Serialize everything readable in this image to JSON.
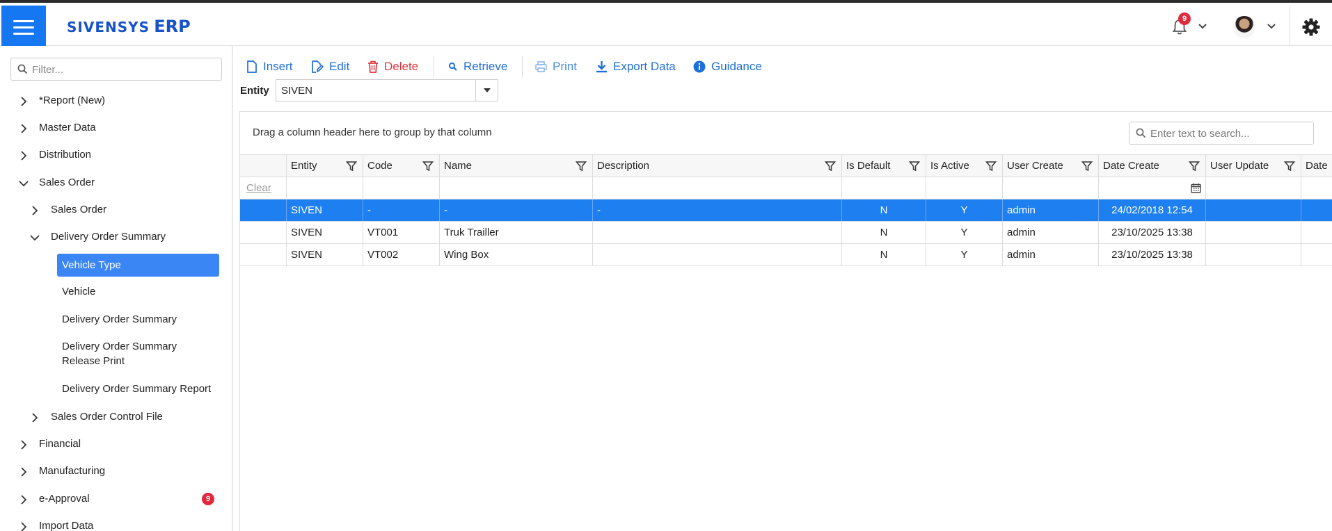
{
  "app": {
    "brand_part1": "SIVENSYS",
    "brand_part2": "ERP",
    "notification_count": "9"
  },
  "sidebar": {
    "filter_placeholder": "Filter...",
    "items": [
      {
        "label": "*Report (New)"
      },
      {
        "label": "Master Data"
      },
      {
        "label": "Distribution"
      },
      {
        "label": "Sales Order"
      },
      {
        "label": "Sales Order"
      },
      {
        "label": "Delivery Order Summary"
      },
      {
        "label": "Vehicle Type"
      },
      {
        "label": "Vehicle"
      },
      {
        "label": "Delivery Order Summary"
      },
      {
        "label": "Delivery Order Summary"
      },
      {
        "label": "Release Print"
      },
      {
        "label": "Delivery Order Summary Report"
      },
      {
        "label": "Sales Order Control File"
      },
      {
        "label": "Financial"
      },
      {
        "label": "Manufacturing"
      },
      {
        "label": "e-Approval",
        "badge": "9"
      },
      {
        "label": "Import Data"
      }
    ]
  },
  "toolbar": {
    "insert": "Insert",
    "edit": "Edit",
    "delete": "Delete",
    "retrieve": "Retrieve",
    "print": "Print",
    "export": "Export Data",
    "guidance": "Guidance"
  },
  "entity": {
    "label": "Entity",
    "value": "SIVEN"
  },
  "grid": {
    "group_hint": "Drag a column header here to group by that column",
    "search_placeholder": "Enter text to search...",
    "clear_label": "Clear",
    "columns": [
      "Entity",
      "Code",
      "Name",
      "Description",
      "Is Default",
      "Is Active",
      "User Create",
      "Date Create",
      "User Update",
      "Date"
    ],
    "rows": [
      {
        "entity": "SIVEN",
        "code": "-",
        "name": "-",
        "description": "-",
        "is_default": "N",
        "is_active": "Y",
        "user_create": "admin",
        "date_create": "24/02/2018 12:54",
        "user_update": "",
        "selected": true
      },
      {
        "entity": "SIVEN",
        "code": "VT001",
        "name": "Truk Trailler",
        "description": "",
        "is_default": "N",
        "is_active": "Y",
        "user_create": "admin",
        "date_create": "23/10/2025 13:38",
        "user_update": "",
        "selected": false
      },
      {
        "entity": "SIVEN",
        "code": "VT002",
        "name": "Wing Box",
        "description": "",
        "is_default": "N",
        "is_active": "Y",
        "user_create": "admin",
        "date_create": "23/10/2025 13:38",
        "user_update": "",
        "selected": false
      }
    ]
  },
  "colors": {
    "accent": "#1677f2",
    "selected_row": "#1e7ff0",
    "danger": "#d9363e",
    "brand": "#1652c9"
  }
}
